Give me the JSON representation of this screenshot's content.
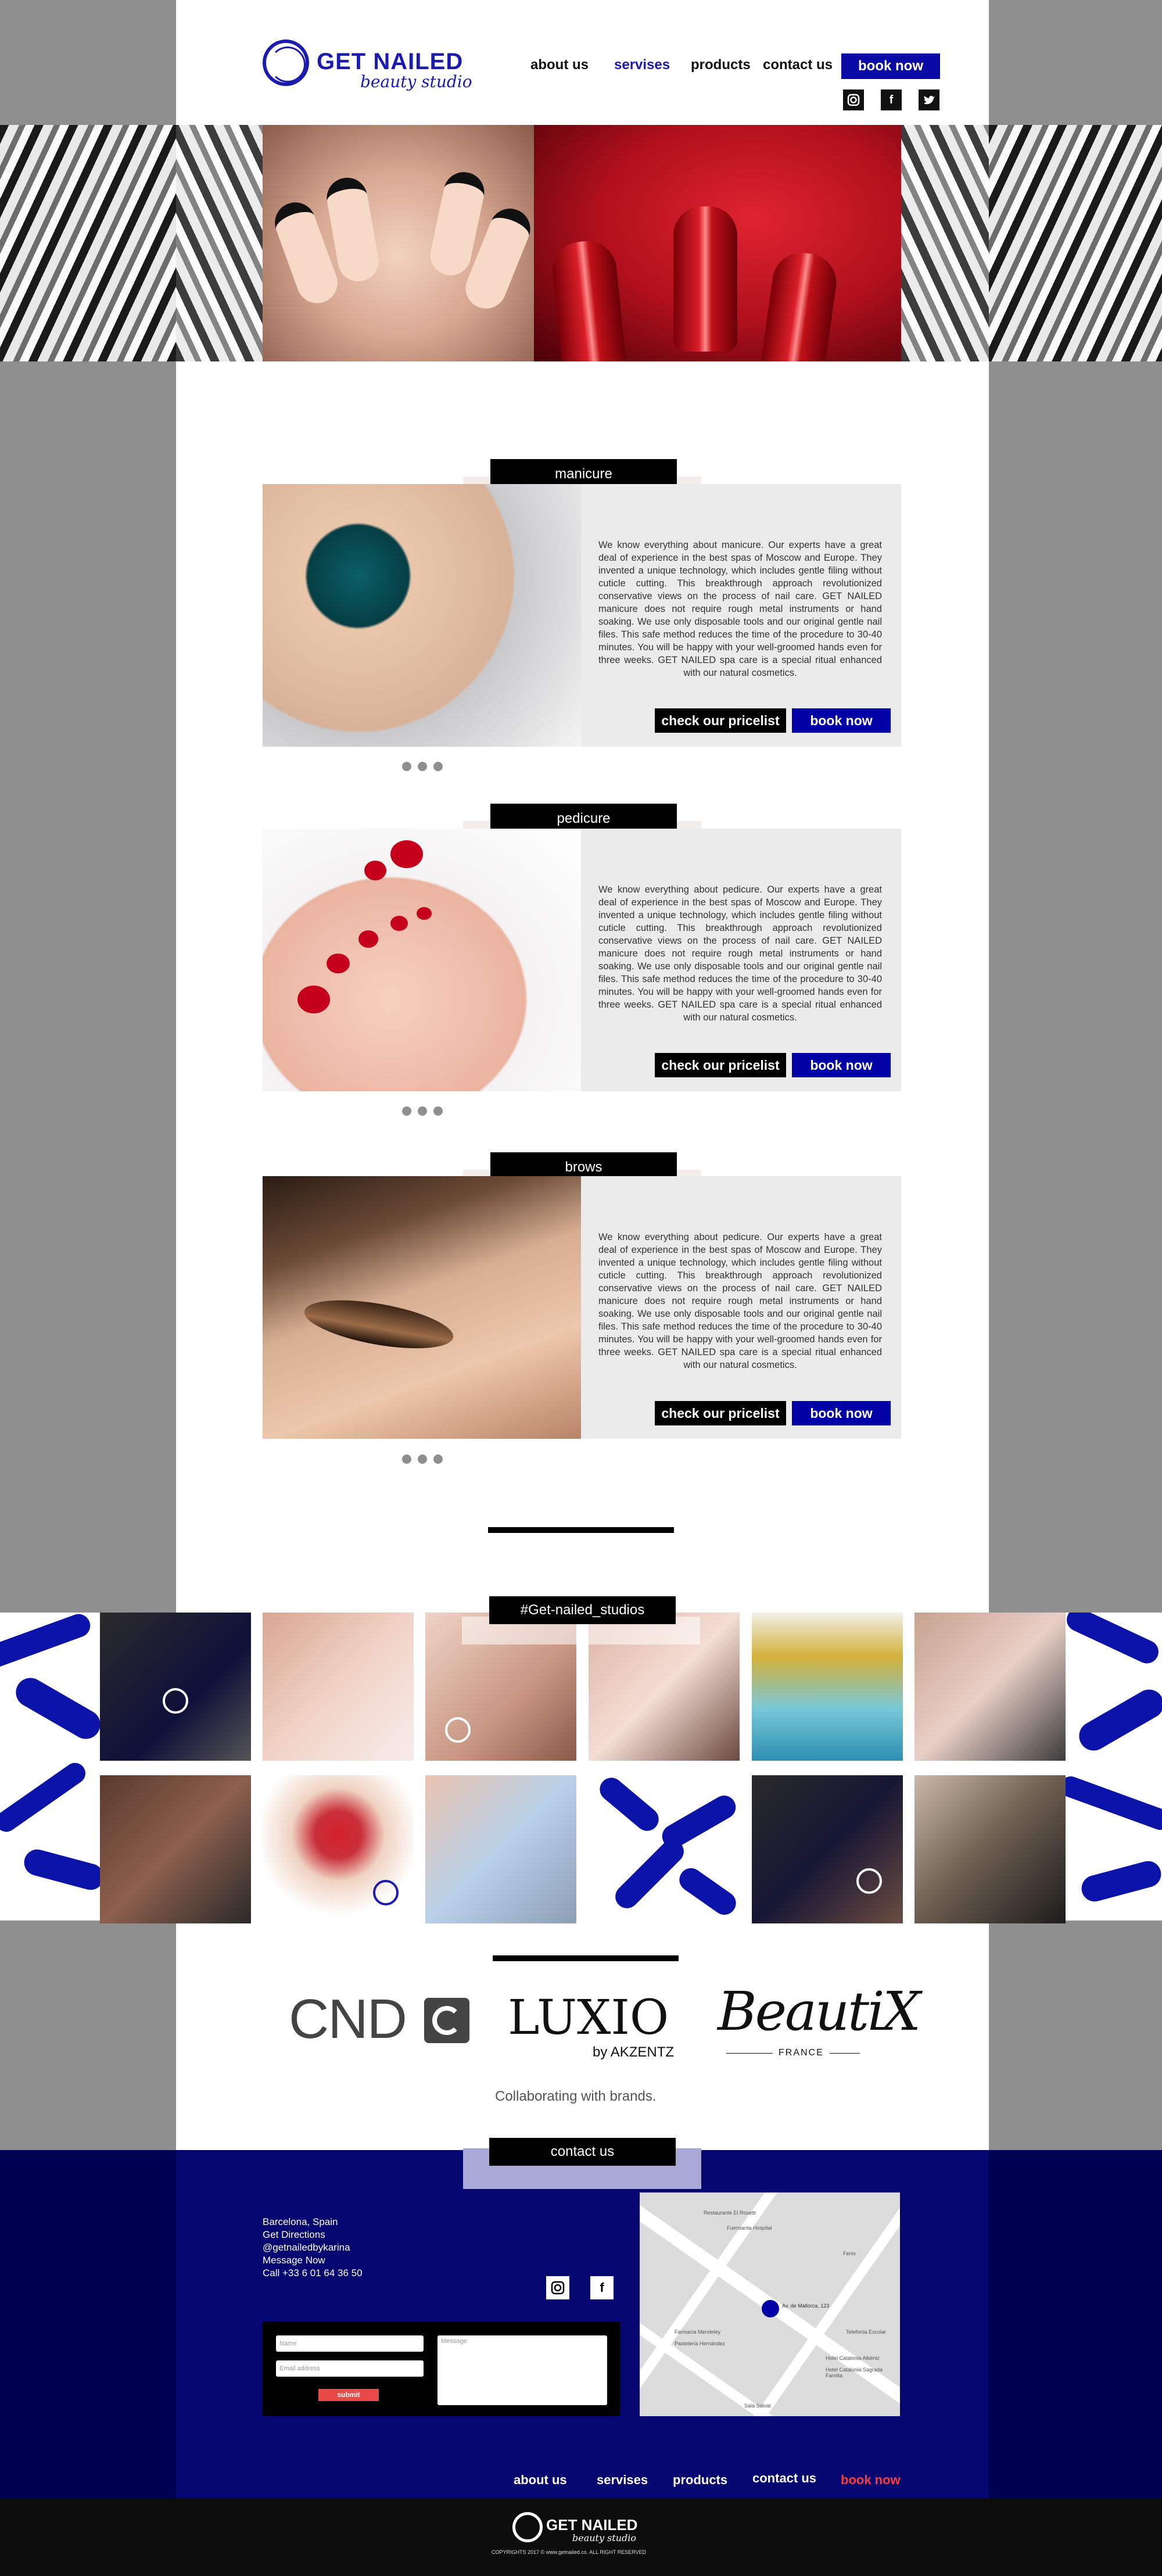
{
  "brand": {
    "name": "GET NAILED",
    "tagline": "beauty studio"
  },
  "nav": {
    "about": "about us",
    "services": "servises",
    "products": "products",
    "contact": "contact us",
    "book": "book now"
  },
  "social": {
    "instagram": "instagram-icon",
    "facebook": "f",
    "twitter": "twitter-icon"
  },
  "colors": {
    "accent": "#0000a6",
    "nav_active": "#1b1bb0",
    "footer": "#060670",
    "submit": "#e84a4a",
    "footer_book": "#ff3a3a"
  },
  "sections": [
    {
      "label": "manicure",
      "text": "We know everything about manicure. Our experts have a great deal of experience in the best spas of Moscow and Europe. They invented a unique technology, which includes gentle filing without cuticle cutting. This breakthrough approach revolutionized conservative views on the process of nail care. GET NAILED manicure does not require rough metal instruments or hand soaking. We use only disposable tools and our original gentle nail files. This safe method reduces the time of the procedure to 30-40 minutes. You will be happy with your well-groomed hands even for three weeks. GET NAILED spa care is a special ritual enhanced with our natural cosmetics.",
      "pricelist": "check our pricelist",
      "book": "book now"
    },
    {
      "label": "pedicure",
      "text": "We know everything about pedicure. Our experts have a great deal of experience in the best spas of Moscow and Europe. They invented a unique technology, which includes gentle filing without cuticle cutting. This breakthrough approach revolutionized conservative views on the process of nail care. GET NAILED manicure does not require rough metal instruments or hand soaking. We use only disposable tools and our original gentle nail files. This safe method reduces the time of the procedure to 30-40 minutes. You will be happy with your well-groomed hands even for three weeks. GET NAILED spa care is a special ritual enhanced with our natural cosmetics.",
      "pricelist": "check our pricelist",
      "book": "book now"
    },
    {
      "label": "brows",
      "text": "We know everything about pedicure. Our experts have a great deal of experience in the best spas of Moscow and Europe. They invented a unique technology, which includes gentle filing without cuticle cutting. This breakthrough approach revolutionized conservative views on the process of nail care. GET NAILED manicure does not require rough metal instruments or hand soaking. We use only disposable tools and our original gentle nail files. This safe method reduces the time of the procedure to 30-40 minutes. You will be happy with your well-groomed hands even for three weeks. GET NAILED spa care is a special ritual enhanced with our natural cosmetics.",
      "pricelist": "check our pricelist",
      "book": "book now"
    }
  ],
  "instagram": {
    "hashtag": "#Get-nailed_studios"
  },
  "brands": {
    "b1": "CND",
    "b2": "LUXIO",
    "b2sub": "by AKZENTZ",
    "b3": "BeautiX",
    "b3sub": "FRANCE",
    "caption": "Collaborating with  brands."
  },
  "contact": {
    "label": "contact us",
    "lines": [
      "Barcelona, Spain",
      "Get Directions",
      "@getnailedbykarina",
      "Message Now",
      "Call +33 6 01 64 36 50"
    ],
    "name_placeholder": "Name",
    "email_placeholder": "Email address",
    "message_placeholder": "Message",
    "submit": "submit"
  },
  "map": {
    "labels": [
      "Restaurante El Rosetti",
      "Fuensanta Hospital",
      "Fenix",
      "Av. de Mallorca, 123",
      "Farmacia Mendeley",
      "Pastelería Hernández",
      "Telefonía Escolar",
      "Hotel Catalonia Albéniz",
      "Hotel Catalonia Sagrada Familia",
      "Sala Salvat"
    ]
  },
  "footer_nav": {
    "about": "about us",
    "services": "servises",
    "products": "products",
    "contact": "contact us",
    "book": "book now"
  },
  "copyright": "COPYRIGHTS 2017 © www.getnailed.co. ALL RIGHT RESERVED"
}
